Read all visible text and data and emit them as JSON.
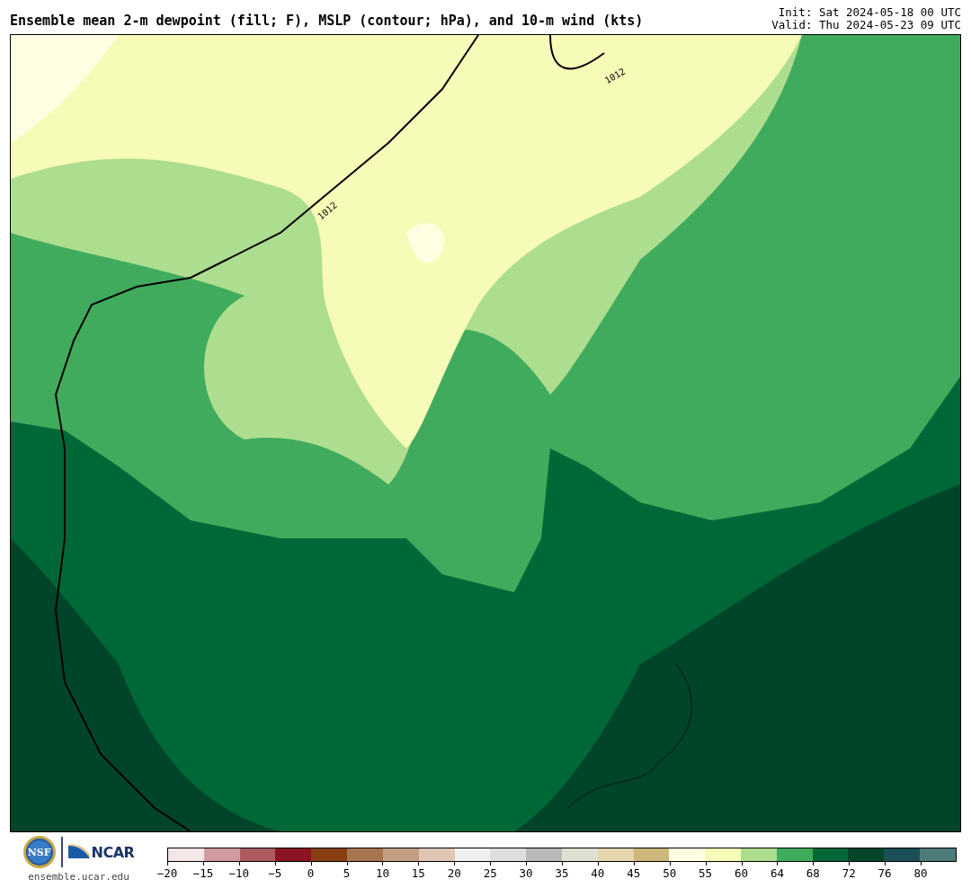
{
  "title": "Ensemble mean 2-m dewpoint (fill; F), MSLP (contour; hPa), and 10-m wind (kts)",
  "init": "Init: Sat 2024-05-18 00 UTC",
  "valid": "Valid: Thu 2024-05-23 09 UTC",
  "map": {
    "contour_labels": [
      "1012",
      "1012"
    ]
  },
  "footer": {
    "nsf_logo": "NSF",
    "ncar_logo": "NCAR",
    "url": "ensemble.ucar.edu"
  },
  "colorbar": [
    {
      "label": "−20",
      "color": "#f3e6e6"
    },
    {
      "label": "−15",
      "color": "#d09a9e"
    },
    {
      "label": "−10",
      "color": "#ac5a60"
    },
    {
      "label": "−5",
      "color": "#8b1420"
    },
    {
      "label": "0",
      "color": "#873e12"
    },
    {
      "label": "5",
      "color": "#a87552"
    },
    {
      "label": "10",
      "color": "#c49e83"
    },
    {
      "label": "15",
      "color": "#e0c7b5"
    },
    {
      "label": "20",
      "color": "#efefef"
    },
    {
      "label": "25",
      "color": "#dedede"
    },
    {
      "label": "30",
      "color": "#b9b9b9"
    },
    {
      "label": "35",
      "color": "#e0e0d2"
    },
    {
      "label": "40",
      "color": "#e5d6b0"
    },
    {
      "label": "45",
      "color": "#cdb77a"
    },
    {
      "label": "50",
      "color": "#fffee3"
    },
    {
      "label": "55",
      "color": "#f7fbb8"
    },
    {
      "label": "60",
      "color": "#addd8e"
    },
    {
      "label": "64",
      "color": "#41ab5d"
    },
    {
      "label": "68",
      "color": "#006837"
    },
    {
      "label": "72",
      "color": "#004529"
    },
    {
      "label": "76",
      "color": "#1b4f55"
    },
    {
      "label": "80",
      "color": "#4e7a7a"
    }
  ]
}
